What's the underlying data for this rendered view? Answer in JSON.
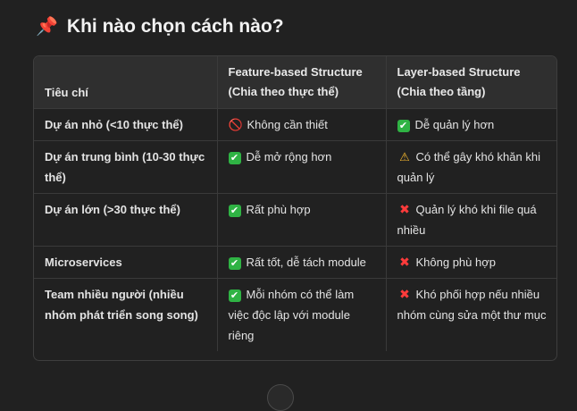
{
  "heading": {
    "icon": "📌",
    "title": "Khi nào chọn cách nào?"
  },
  "table": {
    "headers": [
      [
        "Tiêu chí"
      ],
      [
        "Feature-based Structure",
        "(Chia theo thực thể)"
      ],
      [
        "Layer-based Structure",
        "(Chia theo tầng)"
      ]
    ],
    "rows": [
      {
        "criterion": "Dự án nhỏ (<10 thực thể)",
        "feature": {
          "icon": "🚫",
          "icon_name": "prohibited-icon",
          "text": "Không cần thiết"
        },
        "layer": {
          "icon": "✔",
          "icon_name": "check-icon",
          "text": "Dễ quản lý hơn"
        }
      },
      {
        "criterion": "Dự án trung bình (10-30 thực thể)",
        "feature": {
          "icon": "✔",
          "icon_name": "check-icon",
          "text": "Dễ mở rộng hơn"
        },
        "layer": {
          "icon": "⚠",
          "icon_name": "warning-icon",
          "text": "Có thể gây khó khăn khi quản lý"
        }
      },
      {
        "criterion": "Dự án lớn (>30 thực thể)",
        "feature": {
          "icon": "✔",
          "icon_name": "check-icon",
          "text": "Rất phù hợp"
        },
        "layer": {
          "icon": "✖",
          "icon_name": "cross-icon",
          "text": "Quản lý khó khi file quá nhiều"
        }
      },
      {
        "criterion": "Microservices",
        "feature": {
          "icon": "✔",
          "icon_name": "check-icon",
          "text": "Rất tốt, dễ tách module"
        },
        "layer": {
          "icon": "✖",
          "icon_name": "cross-icon",
          "text": "Không phù hợp"
        }
      },
      {
        "criterion": "Team nhiều người (nhiều nhóm phát triển song song)",
        "feature": {
          "icon": "✔",
          "icon_name": "check-icon",
          "text": "Mỗi nhóm có thể làm việc độc lập với module riêng"
        },
        "layer": {
          "icon": "✖",
          "icon_name": "cross-icon",
          "text": "Khó phối hợp nếu nhiều nhóm cùng sửa một thư mục"
        }
      }
    ]
  },
  "colors": {
    "background": "#212121",
    "header_bg": "#2f2f2f",
    "check": "#2fb344",
    "cross": "#ff3b3b",
    "warning": "#f5b82e"
  }
}
